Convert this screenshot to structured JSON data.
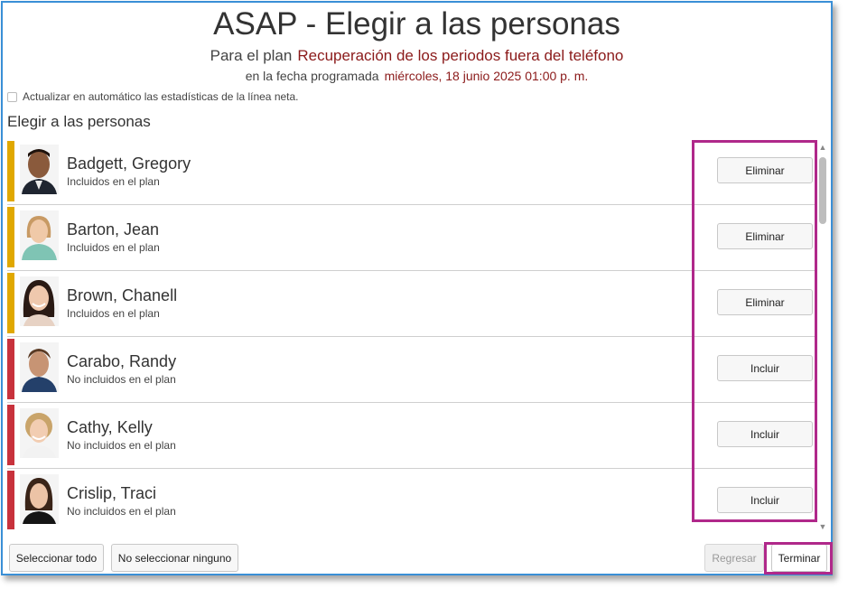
{
  "header": {
    "title": "ASAP - Elegir a las personas",
    "plan_label": "Para el plan",
    "plan_value": "Recuperación de los periodos fuera del teléfono",
    "date_label": "en la fecha programada",
    "date_value": "miércoles, 18 junio 2025 01:00 p. m."
  },
  "auto_update": {
    "label": "Actualizar en automático las estadísticas de la línea neta.",
    "checked": false
  },
  "section_title": "Elegir a las personas",
  "colors": {
    "included": "#e0a800",
    "not_included": "#c8323c",
    "accent_value": "#8b1a1a",
    "highlight": "#b0288a",
    "window_border": "#3a8fd6"
  },
  "people": [
    {
      "name": "Badgett, Gregory",
      "status": "Incluidos en el plan",
      "action": "Eliminar",
      "included": true
    },
    {
      "name": "Barton, Jean",
      "status": "Incluidos en el plan",
      "action": "Eliminar",
      "included": true
    },
    {
      "name": "Brown, Chanell",
      "status": "Incluidos en el plan",
      "action": "Eliminar",
      "included": true
    },
    {
      "name": "Carabo, Randy",
      "status": "No incluidos en el plan",
      "action": "Incluir",
      "included": false
    },
    {
      "name": "Cathy, Kelly",
      "status": "No incluidos en el plan",
      "action": "Incluir",
      "included": false
    },
    {
      "name": "Crislip, Traci",
      "status": "No incluidos en el plan",
      "action": "Incluir",
      "included": false
    }
  ],
  "footer": {
    "select_all": "Seleccionar todo",
    "select_none": "No seleccionar ninguno",
    "back": "Regresar",
    "finish": "Terminar"
  }
}
